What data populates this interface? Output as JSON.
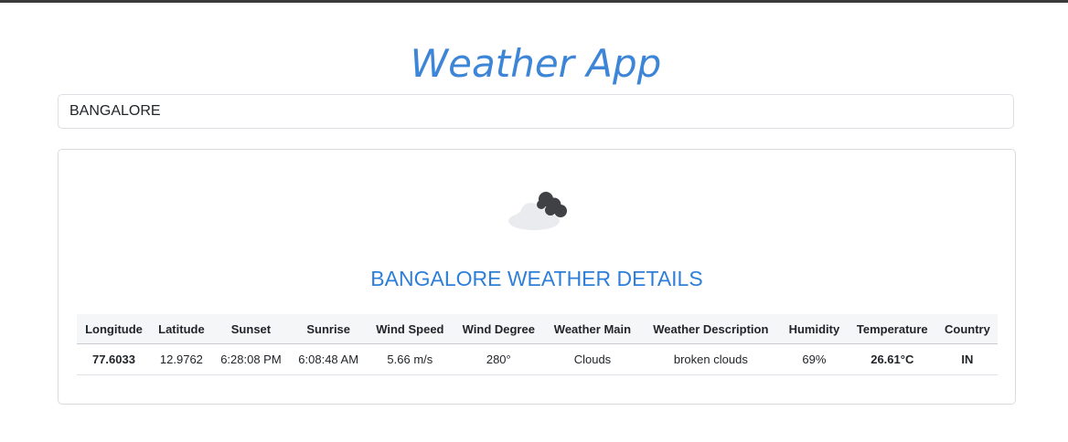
{
  "app": {
    "title": "Weather App"
  },
  "search": {
    "value": "BANGALORE"
  },
  "weather": {
    "icon": "cloud-icon",
    "heading": "BANGALORE WEATHER DETAILS",
    "colors": {
      "accent": "#2f7fd8",
      "temperature": "#1f8a4c",
      "country": "#dc3545"
    },
    "table": {
      "headers": [
        "Longitude",
        "Latitude",
        "Sunset",
        "Sunrise",
        "Wind Speed",
        "Wind Degree",
        "Weather Main",
        "Weather Description",
        "Humidity",
        "Temperature",
        "Country"
      ],
      "row": [
        "77.6033",
        "12.9762",
        "6:28:08 PM",
        "6:08:48 AM",
        "5.66 m/s",
        "280°",
        "Clouds",
        "broken clouds",
        "69%",
        "26.61°C",
        "IN"
      ]
    }
  }
}
